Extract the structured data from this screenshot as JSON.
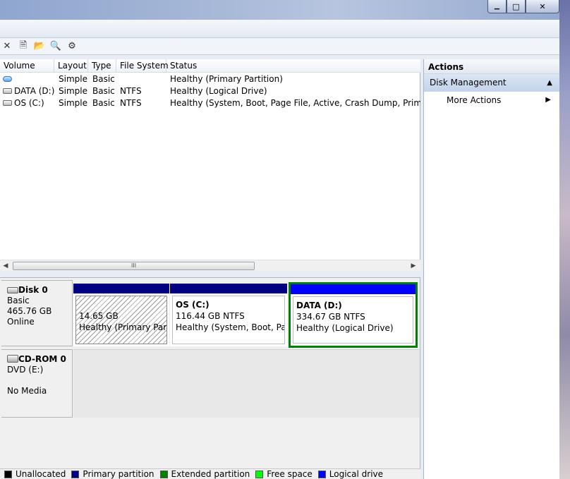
{
  "window": {
    "minimize_symbol": "▁",
    "maximize_symbol": "□",
    "close_symbol": "✕"
  },
  "toolbar": {
    "icons": [
      "close-icon",
      "properties-icon",
      "open-icon",
      "search-icon",
      "settings-icon"
    ],
    "glyphs": [
      "✕",
      "🗎",
      "📂",
      "🔍",
      "⚙"
    ]
  },
  "volume_list": {
    "headers": [
      "Volume",
      "Layout",
      "Type",
      "File System",
      "Status"
    ],
    "rows": [
      {
        "volume": "",
        "layout": "Simple",
        "type": "Basic",
        "fs": "",
        "status": "Healthy (Primary Partition)"
      },
      {
        "volume": "DATA (D:)",
        "layout": "Simple",
        "type": "Basic",
        "fs": "NTFS",
        "status": "Healthy (Logical Drive)"
      },
      {
        "volume": "OS (C:)",
        "layout": "Simple",
        "type": "Basic",
        "fs": "NTFS",
        "status": "Healthy (System, Boot, Page File, Active, Crash Dump, Primary Part"
      }
    ],
    "scroll_grip": "III"
  },
  "disks": [
    {
      "name": "Disk 0",
      "type": "Basic",
      "size": "465.76 GB",
      "state": "Online",
      "partitions": [
        {
          "label": "",
          "size": "14.65 GB",
          "status": "Healthy (Primary Partit"
        },
        {
          "label": "OS  (C:)",
          "size": "116.44 GB NTFS",
          "status": "Healthy (System, Boot, Page"
        },
        {
          "label": "DATA  (D:)",
          "size": "334.67 GB NTFS",
          "status": "Healthy (Logical Drive)"
        }
      ]
    },
    {
      "name": "CD-ROM 0",
      "type": "DVD (E:)",
      "state": "No Media"
    }
  ],
  "legend": [
    {
      "label": "Unallocated",
      "color": "#000000"
    },
    {
      "label": "Primary partition",
      "color": "#000080"
    },
    {
      "label": "Extended partition",
      "color": "#008000"
    },
    {
      "label": "Free space",
      "color": "#00ff00"
    },
    {
      "label": "Logical drive",
      "color": "#0000ff"
    }
  ],
  "actions": {
    "title": "Actions",
    "group": "Disk Management",
    "group_arrow": "▲",
    "items": [
      {
        "label": "More Actions",
        "arrow": "▶"
      }
    ]
  }
}
